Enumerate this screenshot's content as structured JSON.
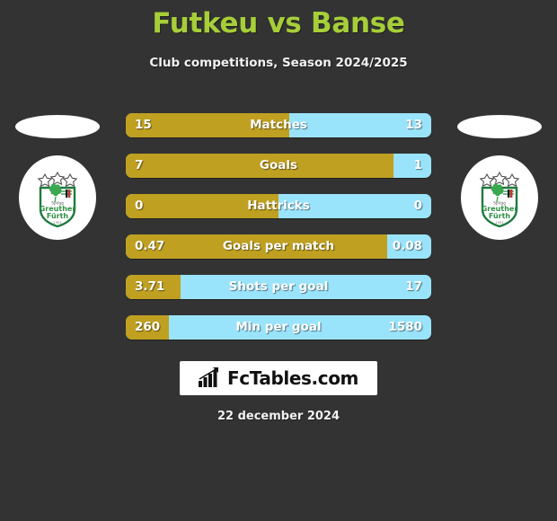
{
  "header": {
    "title": "Futkeu vs Banse",
    "subtitle": "Club competitions, Season 2024/2025",
    "title_color": "#a6ce39"
  },
  "theme": {
    "background": "#333333",
    "home_color": "#bfa021",
    "away_color": "#9ae4fb",
    "text_color": "#ffffff"
  },
  "teams": {
    "home": {
      "crest_name": "spvgg-greuther-furth-crest",
      "crest_text_top": "SpVgg",
      "crest_text_mid": "Greuther",
      "crest_text_bottom": "Fürth",
      "crest_year": "1903"
    },
    "away": {
      "crest_name": "spvgg-greuther-furth-crest",
      "crest_text_top": "SpVgg",
      "crest_text_mid": "Greuther",
      "crest_text_bottom": "Fürth",
      "crest_year": "1903"
    }
  },
  "chart_data": {
    "type": "bar",
    "title": "Futkeu vs Banse",
    "subtitle": "Club competitions, Season 2024/2025",
    "orientation": "horizontal-diverging",
    "legend": [
      "Futkeu",
      "Banse"
    ],
    "categories": [
      "Matches",
      "Goals",
      "Hattricks",
      "Goals per match",
      "Shots per goal",
      "Min per goal"
    ],
    "series": [
      {
        "name": "Futkeu",
        "color": "#bfa021",
        "values": [
          15,
          7,
          0,
          0.47,
          3.71,
          260
        ]
      },
      {
        "name": "Banse",
        "color": "#9ae4fb",
        "values": [
          13,
          1,
          0,
          0.08,
          17,
          1580
        ]
      }
    ]
  },
  "rows": [
    {
      "label": "Matches",
      "home": "15",
      "away": "13",
      "fill_pct": 53.6
    },
    {
      "label": "Goals",
      "home": "7",
      "away": "1",
      "fill_pct": 87.5
    },
    {
      "label": "Hattricks",
      "home": "0",
      "away": "0",
      "fill_pct": 50.0
    },
    {
      "label": "Goals per match",
      "home": "0.47",
      "away": "0.08",
      "fill_pct": 85.5
    },
    {
      "label": "Shots per goal",
      "home": "3.71",
      "away": "17",
      "fill_pct": 17.9
    },
    {
      "label": "Min per goal",
      "home": "260",
      "away": "1580",
      "fill_pct": 14.1
    }
  ],
  "footer": {
    "brand": "FcTables.com",
    "brand_icon": "bar-chart-icon",
    "date": "22 december 2024"
  }
}
